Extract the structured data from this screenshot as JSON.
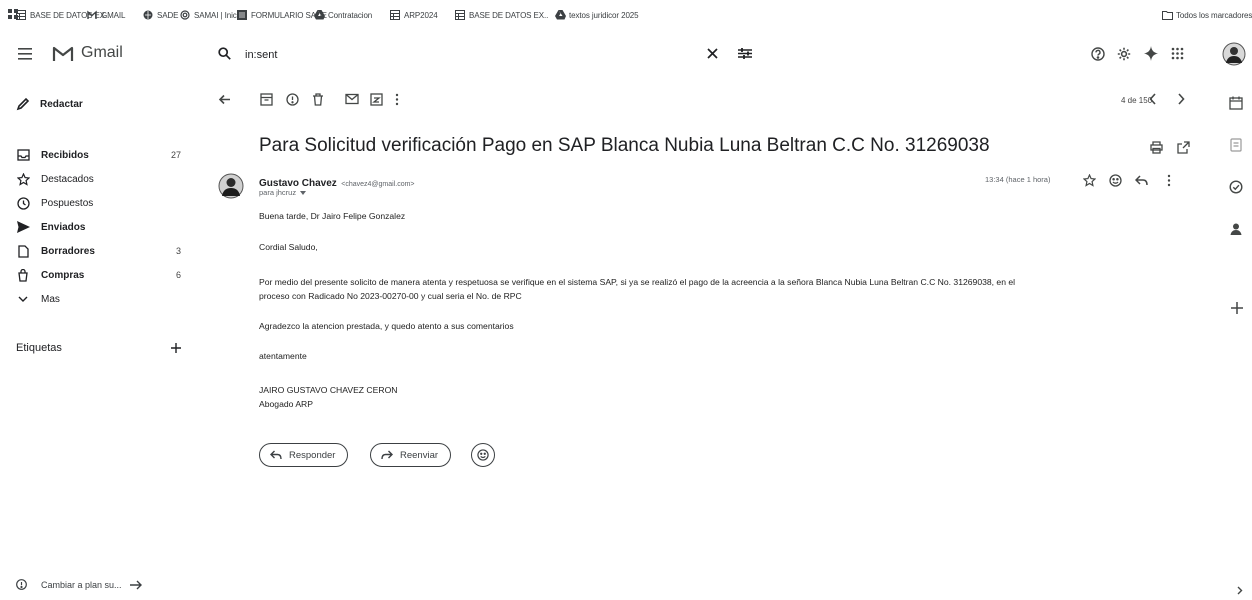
{
  "bookmarks": [
    {
      "label": "BASE DE DATOS EX..",
      "icon": "sheets-icon"
    },
    {
      "label": "GMAIL",
      "icon": "gmail-icon"
    },
    {
      "label": "SADE",
      "icon": "globe-icon"
    },
    {
      "label": "SAMAI | Inicio",
      "icon": "gear-icon"
    },
    {
      "label": "FORMULARIO SADE",
      "icon": "forms-icon"
    },
    {
      "label": "Contratacion",
      "icon": "drive-icon"
    },
    {
      "label": "ARP2024",
      "icon": "sheets-icon"
    },
    {
      "label": "BASE DE DATOS EX..",
      "icon": "sheets-icon"
    },
    {
      "label": "textos juridicor 2025",
      "icon": "drive-icon"
    }
  ],
  "all_bookmarks_label": "Todos los marcadores",
  "app": {
    "name": "Gmail"
  },
  "search": {
    "value": "in:sent"
  },
  "compose_label": "Redactar",
  "nav": [
    {
      "label": "Recibidos",
      "count": "27",
      "bold": true,
      "icon": "inbox-icon"
    },
    {
      "label": "Destacados",
      "count": "",
      "bold": false,
      "icon": "star-icon"
    },
    {
      "label": "Pospuestos",
      "count": "",
      "bold": false,
      "icon": "clock-icon"
    },
    {
      "label": "Enviados",
      "count": "",
      "bold": true,
      "icon": "send-icon"
    },
    {
      "label": "Borradores",
      "count": "3",
      "bold": true,
      "icon": "draft-icon"
    },
    {
      "label": "Compras",
      "count": "6",
      "bold": true,
      "icon": "tag-icon"
    },
    {
      "label": "Mas",
      "count": "",
      "bold": false,
      "icon": "chevron-down-icon"
    }
  ],
  "labels_heading": "Etiquetas",
  "plan_label": "Cambiar a plan su...",
  "pagination": "4 de 150",
  "email": {
    "subject": "Para Solicitud verificación Pago en SAP Blanca Nubia Luna Beltran C.C No. 31269038",
    "sender_name": "Gustavo Chavez",
    "sender_email": "<chavez4@gmail.com>",
    "recipient": "para jhcruz",
    "time": "13:34 (hace 1 hora)",
    "body": [
      "Buena tarde, Dr Jairo Felipe Gonzalez",
      "Cordial Saludo,",
      "Por medio del presente solicito de manera atenta y respetuosa se verifique en el sistema SAP, si ya se realizó el pago de la acreencia a la señora Blanca Nubia Luna Beltran C.C No. 31269038, en el",
      "proceso con Radicado No 2023-00270-00 y cual seria el No. de RPC",
      "Agradezco la atencion prestada, y quedo atento a sus comentarios",
      "atentamente",
      "JAIRO GUSTAVO CHAVEZ CERON",
      "Abogado ARP"
    ]
  },
  "reply_label": "Responder",
  "forward_label": "Reenviar",
  "colors": {
    "accent": "#1a73e8",
    "text": "#202124",
    "icon": "#444746"
  }
}
